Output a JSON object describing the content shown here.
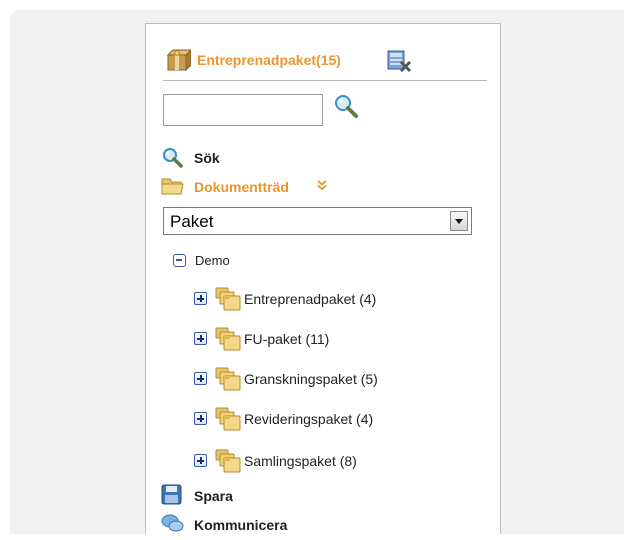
{
  "header": {
    "title": "Entreprenadpaket(15)"
  },
  "search": {
    "value": "",
    "placeholder": ""
  },
  "nav": {
    "sok": "Sök",
    "dokumenttrad": "Dokumentträd",
    "spara": "Spara",
    "kommunicera": "Kommunicera"
  },
  "select": {
    "value": "Paket"
  },
  "tree": {
    "root": "Demo",
    "children": [
      "Entreprenadpaket (4)",
      "FU-paket (11)",
      "Granskningspaket (5)",
      "Revideringspaket (4)",
      "Samlingspaket (8)"
    ]
  },
  "colors": {
    "accent": "#e8962e",
    "tree_blue": "#3b5aa8",
    "background": "#f1f1f1"
  }
}
